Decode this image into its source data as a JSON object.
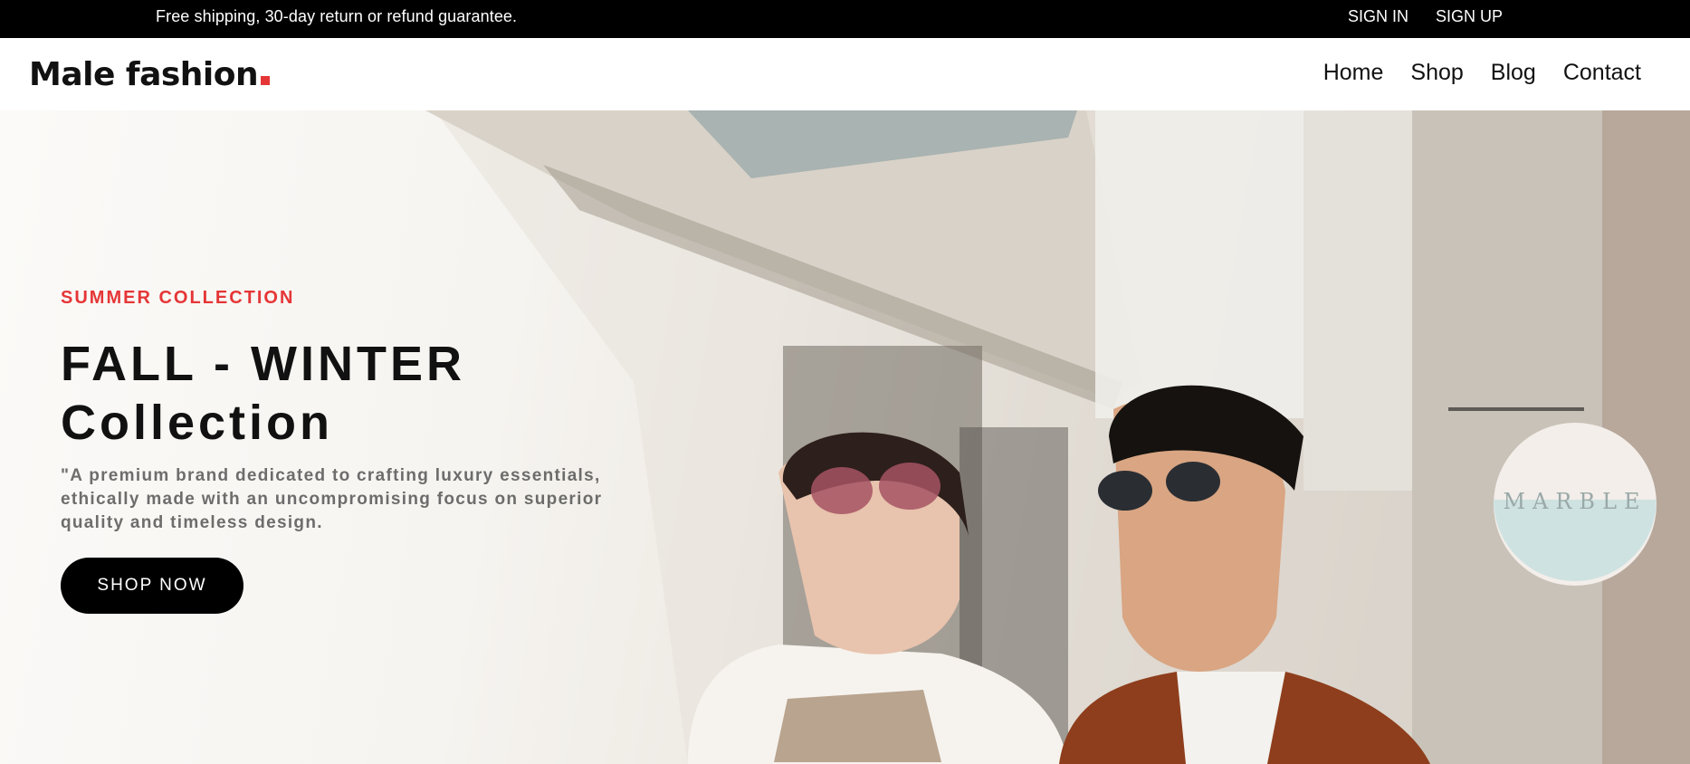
{
  "topbar": {
    "promo": "Free shipping, 30-day return or refund guarantee.",
    "sign_in": "SIGN IN",
    "sign_up": "SIGN UP"
  },
  "header": {
    "logo_text": "Male fashion",
    "logo_accent_color": "#e53637",
    "nav": [
      "Home",
      "Shop",
      "Blog",
      "Contact"
    ]
  },
  "hero": {
    "subtitle": "SUMMER COLLECTION",
    "title_line1": "FALL - WINTER",
    "title_line2": "Collection",
    "description": "\"A premium brand dedicated to crafting luxury essentials, ethically made with an uncompromising focus on superior quality and timeless design.",
    "cta_label": "SHOP NOW",
    "image": "hero-photo-couple-street",
    "sign_text": "MARBLE"
  },
  "colors": {
    "accent": "#e53637",
    "dark": "#111111",
    "topbar_bg": "#000000"
  }
}
